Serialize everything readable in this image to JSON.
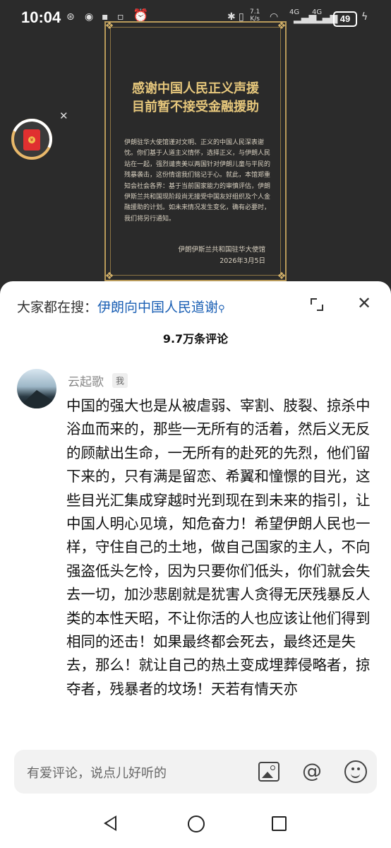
{
  "status_bar": {
    "time": "10:04",
    "network_speed": "7.1\nK/s",
    "signal1": "4G",
    "signal2": "4G",
    "battery": "49"
  },
  "poster": {
    "title_line1": "感谢中国人民正义声援",
    "title_line2": "目前暂不接受金融援助",
    "body": "伊朗驻华大使馆谨对文明、正义的中国人民深表谢忱。你们基于人道主义情怀，选择正义，与伊朗人民站在一起，强烈谴责美以两国针对伊朗儿童与平民的残暴袭击，这份情谊我们铭记于心。就此，本馆郑重知会社会各界：基于当前国家能力的审慎评估，伊朗伊斯兰共和国现阶段尚无接受中国友好组织及个人金融援助的计划。如未来情况发生变化，确有必要时，我们将另行通知。",
    "signature": "伊朗伊斯兰共和国驻华大使馆",
    "date": "2026年3月5日"
  },
  "red_packet": {
    "icon": "red-envelope-icon",
    "currency": "¥"
  },
  "sheet": {
    "search_prefix": "大家都在搜：",
    "search_keyword": "伊朗向中国人民道谢",
    "comment_count": "9.7万条评论"
  },
  "comment": {
    "username": "云起歌",
    "badge": "我",
    "text": "中国的强大也是从被虐弱、宰割、肢裂、掠杀中浴血而来的，那些一无所有的活着，然后义无反的顾献出生命，一无所有的赴死的先烈，他们留下来的，只有满是留恋、希翼和憧憬的目光，这些目光汇集成穿越时光到现在到未来的指引，让中国人明心见境，知危奋力！希望伊朗人民也一样，守住自己的土地，做自己国家的主人，不向强盗低头乞怜，因为只要你们低头，你们就会失去一切，加沙悲剧就是犹害人贪得无厌残暴反人类的本性天昭，不让你活的人也应该让他们得到相同的还击！如果最终都会死去，最终还是失去，那么！就让自己的热土变成埋葬侵略者，掠夺者，残暴者的坟场！天若有情天亦"
  },
  "input": {
    "placeholder": "有爱评论，说点儿好听的"
  }
}
